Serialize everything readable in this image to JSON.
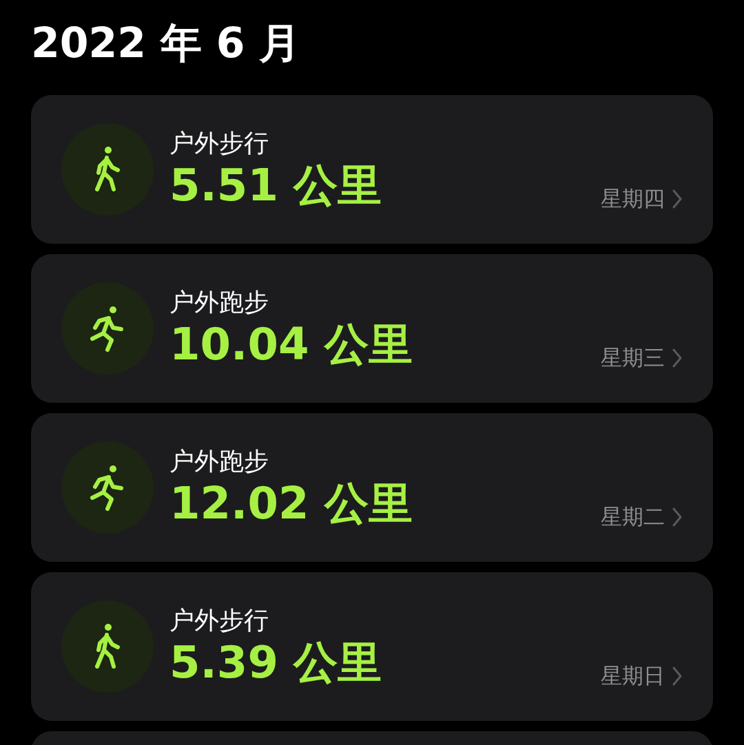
{
  "header": {
    "title": "2022 年 6 月"
  },
  "workouts": [
    {
      "kind": "walk",
      "name": "户外步行",
      "distance": "5.51",
      "unit": "公里",
      "day": "星期四"
    },
    {
      "kind": "run",
      "name": "户外跑步",
      "distance": "10.04",
      "unit": "公里",
      "day": "星期三"
    },
    {
      "kind": "run",
      "name": "户外跑步",
      "distance": "12.02",
      "unit": "公里",
      "day": "星期二"
    },
    {
      "kind": "walk",
      "name": "户外步行",
      "distance": "5.39",
      "unit": "公里",
      "day": "星期日"
    }
  ]
}
